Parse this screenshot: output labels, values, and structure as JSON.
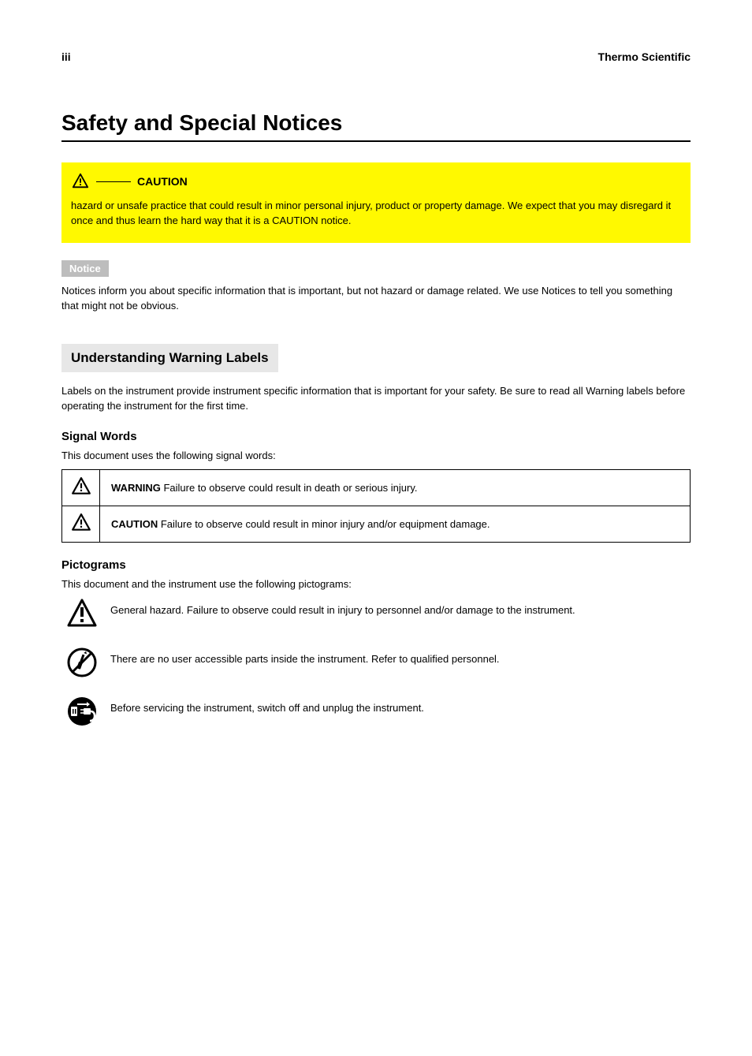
{
  "page_number": "iii",
  "brand": "Thermo Scientific",
  "title": "Safety and Special Notices",
  "caution": {
    "head_label": "CAUTION",
    "text": "hazard or unsafe practice that could result in minor personal injury, product or property damage. We expect that you may disregard it once and thus learn the hard way that it is a CAUTION notice."
  },
  "notice": {
    "badge": "Notice",
    "text": "Notices inform you about specific information that is important, but not hazard or damage related. We use Notices to tell you something that might not be obvious."
  },
  "labels_heading": "Understanding Warning Labels",
  "labels_intro": "Labels on the instrument provide instrument specific information that is important for your safety. Be sure to read all Warning labels before operating the instrument for the first time.",
  "signal_words": {
    "heading": "Signal Words",
    "intro": "This document uses the following signal words:",
    "rows": [
      {
        "word": "WARNING",
        "desc": "Failure to observe could result in death or serious injury."
      },
      {
        "word": "CAUTION",
        "desc": "Failure to observe could result in minor injury and/or equipment damage."
      }
    ]
  },
  "pictograms": {
    "heading": "Pictograms",
    "intro": "This document and the instrument use the following pictograms:",
    "rows": [
      {
        "icon": "warning-triangle",
        "text": "General hazard. Failure to observe could result in injury to personnel and/or damage to the instrument."
      },
      {
        "icon": "no-screwdriver",
        "text": "There are no user accessible parts inside the instrument. Refer to qualified personnel."
      },
      {
        "icon": "unplug",
        "text": "Before servicing the instrument, switch off and unplug the instrument."
      }
    ]
  }
}
